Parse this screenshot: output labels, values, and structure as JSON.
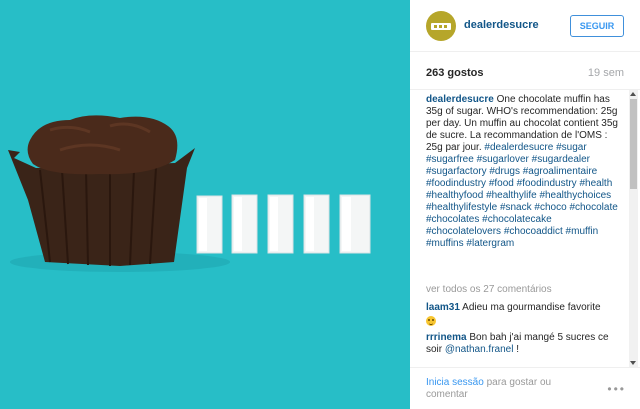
{
  "post": {
    "colors": {
      "photo_background": "#27bec7",
      "link": "#125688",
      "button": "#3897f0"
    },
    "header": {
      "username": "dealerdesucre",
      "follow_label": "SEGUIR"
    },
    "stats": {
      "likes": "263 gostos",
      "time": "19 sem"
    },
    "caption": {
      "username": "dealerdesucre",
      "text": "One chocolate muffin has 35g of sugar. WHO's recommendation: 25g per day. Un muffin au chocolat contient 35g de sucre. La recommandation de l'OMS : 25g par jour.",
      "hashtags": [
        "#dealerdesucre",
        "#sugar",
        "#sugarfree",
        "#sugarlover",
        "#sugardealer",
        "#sugarfactory",
        "#drugs",
        "#agroalimentaire",
        "#foodindustry",
        "#food",
        "#foodindustry",
        "#health",
        "#healthyfood",
        "#healthylife",
        "#healthychoices",
        "#healthylifestyle",
        "#snack",
        "#choco",
        "#chocolate",
        "#chocolates",
        "#chocolatecake",
        "#chocolatelovers",
        "#chocoaddict",
        "#muffin",
        "#muffins",
        "#latergram"
      ]
    },
    "view_all": "ver todos os 27 comentários",
    "comments": [
      {
        "user": "laam31",
        "text": "Adieu ma gourmandise favorite",
        "emoji": "smiley-emoji"
      },
      {
        "user": "rrrinema",
        "text": "Bon bah j'ai mangé 5 sucres ce soir",
        "mention": "@nathan.franel",
        "suffix": "!"
      }
    ],
    "footer": {
      "login_link": "Inicia sessão",
      "login_rest": "para gostar ou comentar",
      "more_label": "•••"
    }
  }
}
